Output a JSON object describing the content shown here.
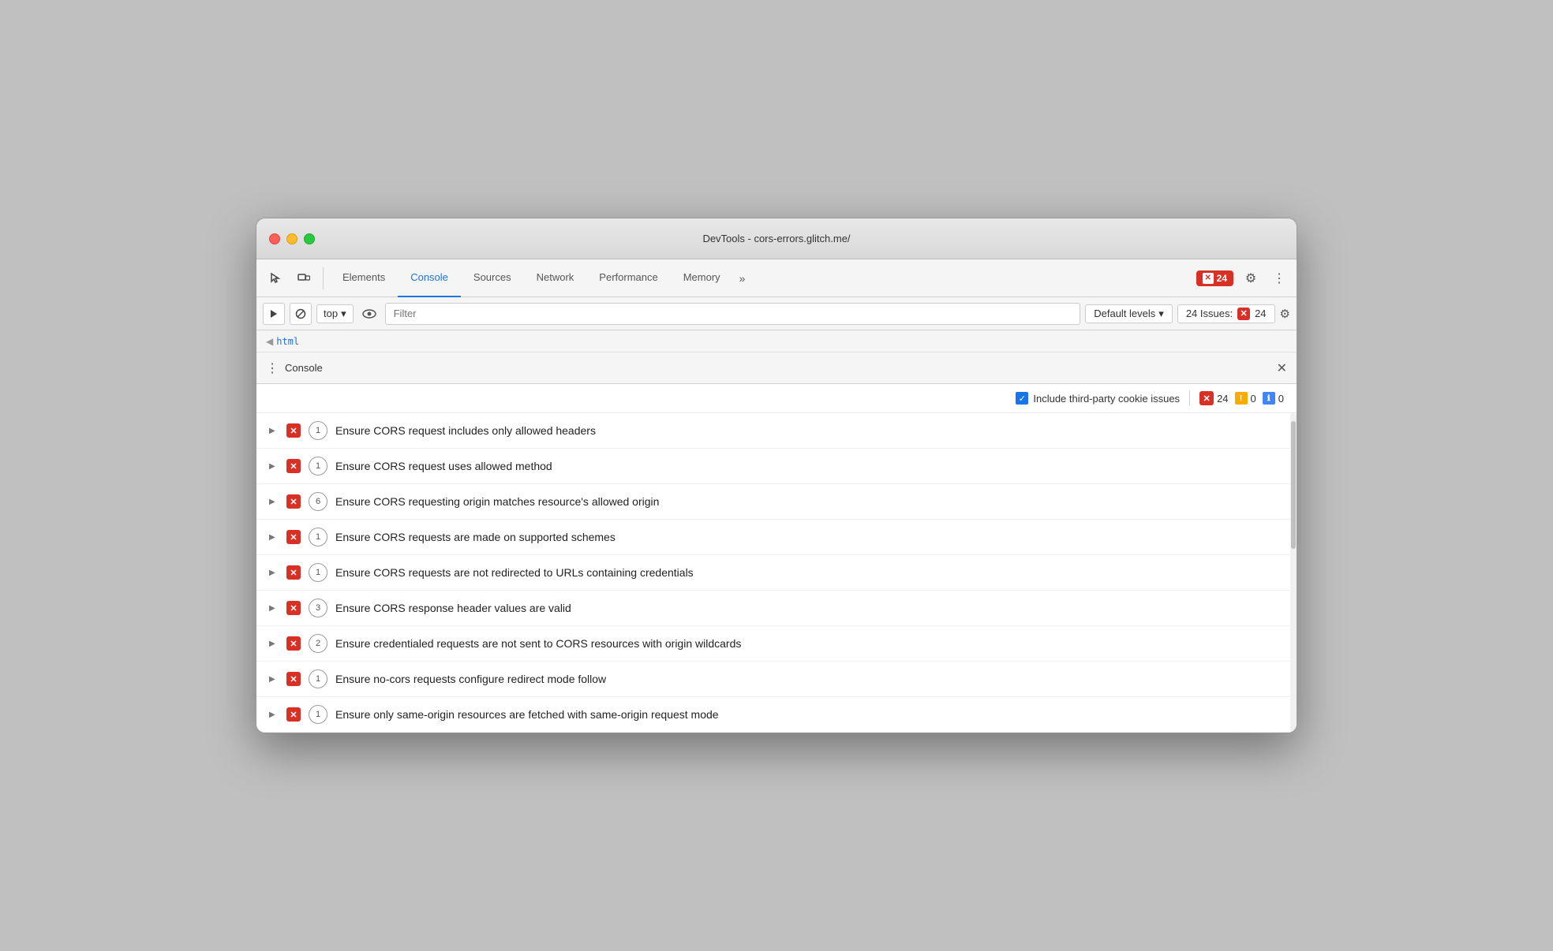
{
  "window": {
    "title": "DevTools - cors-errors.glitch.me/"
  },
  "tabs": [
    {
      "id": "elements",
      "label": "Elements",
      "active": false
    },
    {
      "id": "console",
      "label": "Console",
      "active": true
    },
    {
      "id": "sources",
      "label": "Sources",
      "active": false
    },
    {
      "id": "network",
      "label": "Network",
      "active": false
    },
    {
      "id": "performance",
      "label": "Performance",
      "active": false
    },
    {
      "id": "memory",
      "label": "Memory",
      "active": false
    }
  ],
  "overflow_label": "»",
  "error_count": "24",
  "toolbar": {
    "settings_label": "⚙",
    "more_label": "⋮"
  },
  "console_toolbar": {
    "play_icon": "▶",
    "block_icon": "⊘",
    "top_label": "top",
    "eye_icon": "👁",
    "filter_placeholder": "Filter",
    "levels_label": "Default levels",
    "issues_label": "24 Issues:",
    "issues_count": "24",
    "gear_icon": "⚙"
  },
  "breadcrumb": {
    "arrow": "◀",
    "text": "html"
  },
  "drawer": {
    "menu_icon": "⋮",
    "title": "Console",
    "close_icon": "✕"
  },
  "issues_panel": {
    "include_label": "Include third-party cookie issues",
    "error_count": "24",
    "warn_count": "0",
    "info_count": "0"
  },
  "issues": [
    {
      "text": "Ensure CORS request includes only allowed headers",
      "count": "1"
    },
    {
      "text": "Ensure CORS request uses allowed method",
      "count": "1"
    },
    {
      "text": "Ensure CORS requesting origin matches resource's allowed origin",
      "count": "6"
    },
    {
      "text": "Ensure CORS requests are made on supported schemes",
      "count": "1"
    },
    {
      "text": "Ensure CORS requests are not redirected to URLs containing credentials",
      "count": "1"
    },
    {
      "text": "Ensure CORS response header values are valid",
      "count": "3"
    },
    {
      "text": "Ensure credentialed requests are not sent to CORS resources with origin wildcards",
      "count": "2"
    },
    {
      "text": "Ensure no-cors requests configure redirect mode follow",
      "count": "1"
    },
    {
      "text": "Ensure only same-origin resources are fetched with same-origin request mode",
      "count": "1"
    }
  ]
}
